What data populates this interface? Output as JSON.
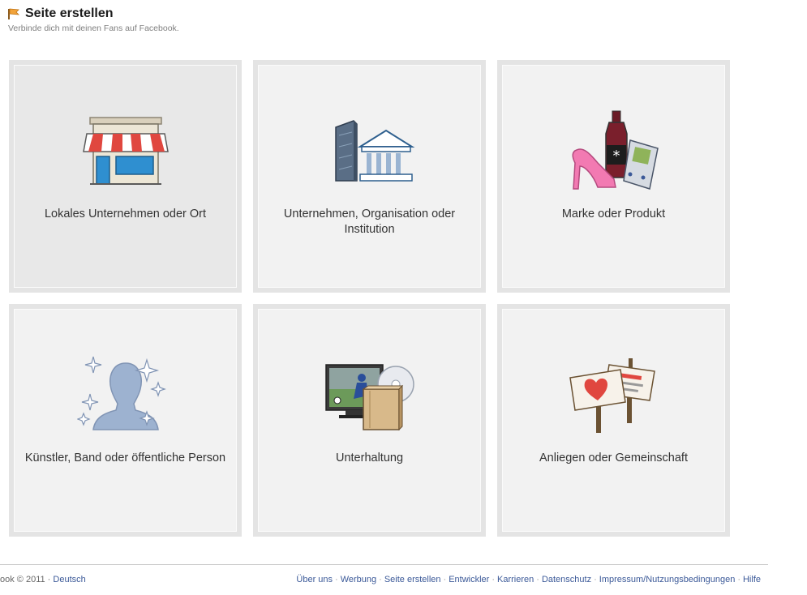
{
  "header": {
    "title": "Seite erstellen",
    "subtitle": "Verbinde dich mit deinen Fans auf Facebook."
  },
  "tiles": [
    {
      "label": "Lokales Unternehmen oder Ort",
      "icon": "storefront-icon"
    },
    {
      "label": "Unternehmen, Organisation oder Institution",
      "icon": "buildings-icon"
    },
    {
      "label": "Marke oder Produkt",
      "icon": "products-icon"
    },
    {
      "label": "Künstler, Band oder öffentliche Person",
      "icon": "person-silhouette-icon"
    },
    {
      "label": "Unterhaltung",
      "icon": "entertainment-icon"
    },
    {
      "label": "Anliegen oder Gemeinschaft",
      "icon": "signs-icon"
    }
  ],
  "footer": {
    "copyright": "ook © 2011 ·",
    "language": "Deutsch",
    "links": [
      "Über uns",
      "Werbung",
      "Seite erstellen",
      "Entwickler",
      "Karrieren",
      "Datenschutz",
      "Impressum/Nutzungsbedingungen",
      "Hilfe"
    ]
  }
}
